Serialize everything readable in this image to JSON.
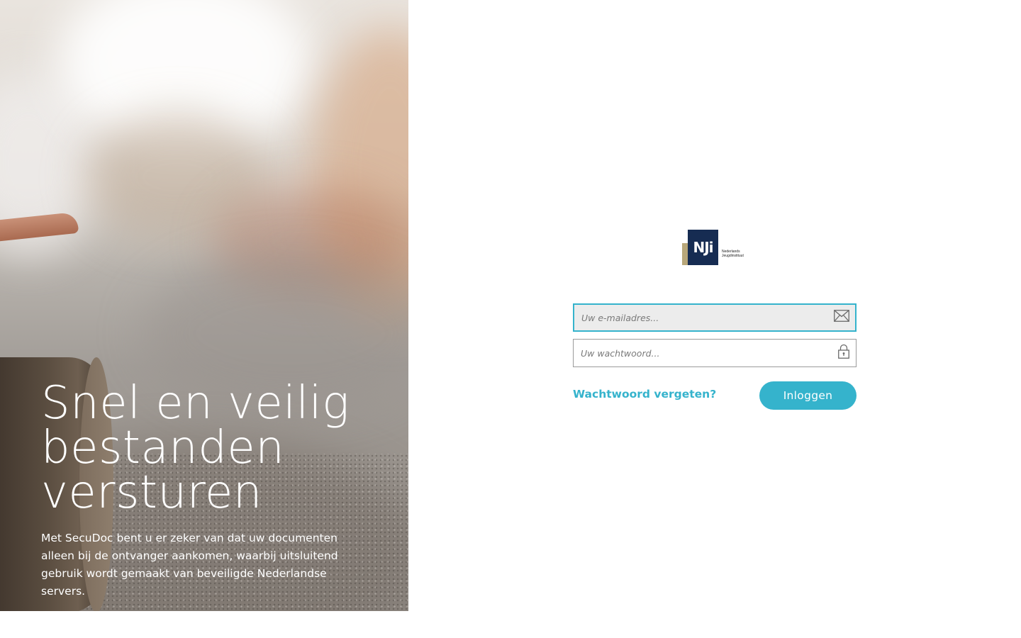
{
  "hero": {
    "title_line1": "Snel en veilig",
    "title_line2": "bestanden",
    "title_line3": "versturen",
    "subtitle": "Met SecuDoc bent u er zeker van dat uw documenten alleen bij de ontvanger aankomen, waarbij uitsluitend gebruik wordt gemaakt van beveiligde Nederlandse servers."
  },
  "logo": {
    "mark": "NJi",
    "org_line1": "Nederlands",
    "org_line2": "Jeugdinstituut",
    "icon": "nji-logo"
  },
  "form": {
    "email_placeholder": "Uw e-mailadres...",
    "email_value": "",
    "email_icon": "envelope-icon",
    "password_placeholder": "Uw wachtwoord...",
    "password_value": "",
    "password_icon": "lock-icon",
    "forgot_label": "Wachtwoord vergeten?",
    "login_label": "Inloggen"
  },
  "colors": {
    "accent": "#35b3cc",
    "logo_navy": "#162c52",
    "logo_gold": "#b8a77a"
  }
}
